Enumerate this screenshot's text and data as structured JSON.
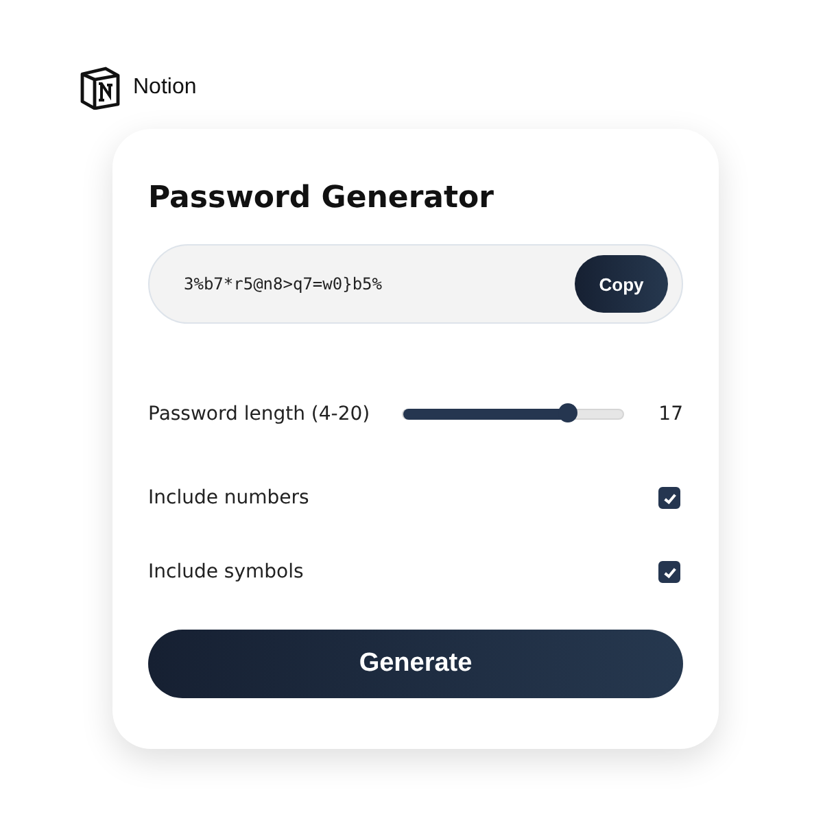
{
  "brand": {
    "name": "Notion"
  },
  "card": {
    "title": "Password Generator",
    "password": {
      "value": "3%b7*r5@n8>q7=w0}b5%",
      "copy_label": "Copy"
    },
    "length": {
      "label": "Password length (4-20)",
      "level": 0.75,
      "reading": "17"
    },
    "options": [
      {
        "label": "Include numbers",
        "checked": true
      },
      {
        "label": "Include symbols",
        "checked": true
      }
    ],
    "generate_label": "Generate"
  }
}
